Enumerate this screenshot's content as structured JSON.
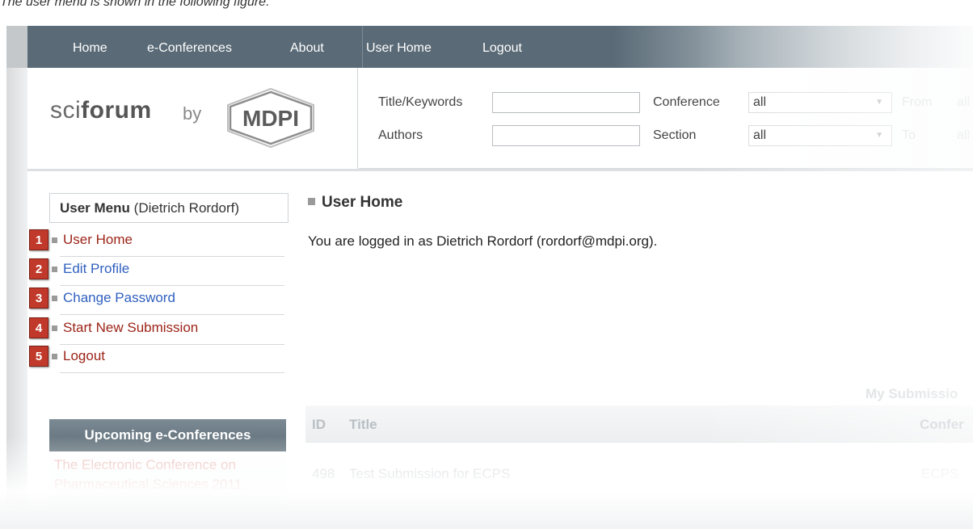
{
  "caption": "The user menu is shown in the following figure.",
  "nav": {
    "items": [
      "Home",
      "e-Conferences",
      "About",
      "User Home",
      "Logout"
    ]
  },
  "logo": {
    "sci": "sci",
    "forum": "forum",
    "by": "by",
    "mdpi": "MDPI"
  },
  "search": {
    "title_keywords_label": "Title/Keywords",
    "authors_label": "Authors",
    "conference_label": "Conference",
    "section_label": "Section",
    "conference_value": "all",
    "section_value": "all",
    "from_label": "From",
    "to_label": "To",
    "from_value": "all",
    "to_value": "all"
  },
  "sidebar": {
    "user_menu_title": "User Menu",
    "user_name": "(Dietrich Rordorf)",
    "items": [
      {
        "num": "1",
        "label": "User Home"
      },
      {
        "num": "2",
        "label": "Edit Profile"
      },
      {
        "num": "3",
        "label": "Change Password"
      },
      {
        "num": "4",
        "label": "Start New Submission"
      },
      {
        "num": "5",
        "label": "Logout"
      }
    ],
    "upcoming_title": "Upcoming e-Conferences",
    "upcoming_text": "The Electronic Conference on Pharmaceutical Sciences 2011"
  },
  "main": {
    "title": "User Home",
    "logged_in_text": "You are logged in as Dietrich Rordorf (rordorf@mdpi.org).",
    "my_submissions": "My Submissio",
    "table": {
      "headers": [
        "ID",
        "Title",
        "Confer"
      ],
      "rows": [
        {
          "id": "498",
          "title": "Test Submission for ECPS",
          "extra": "ECPS"
        }
      ]
    }
  }
}
